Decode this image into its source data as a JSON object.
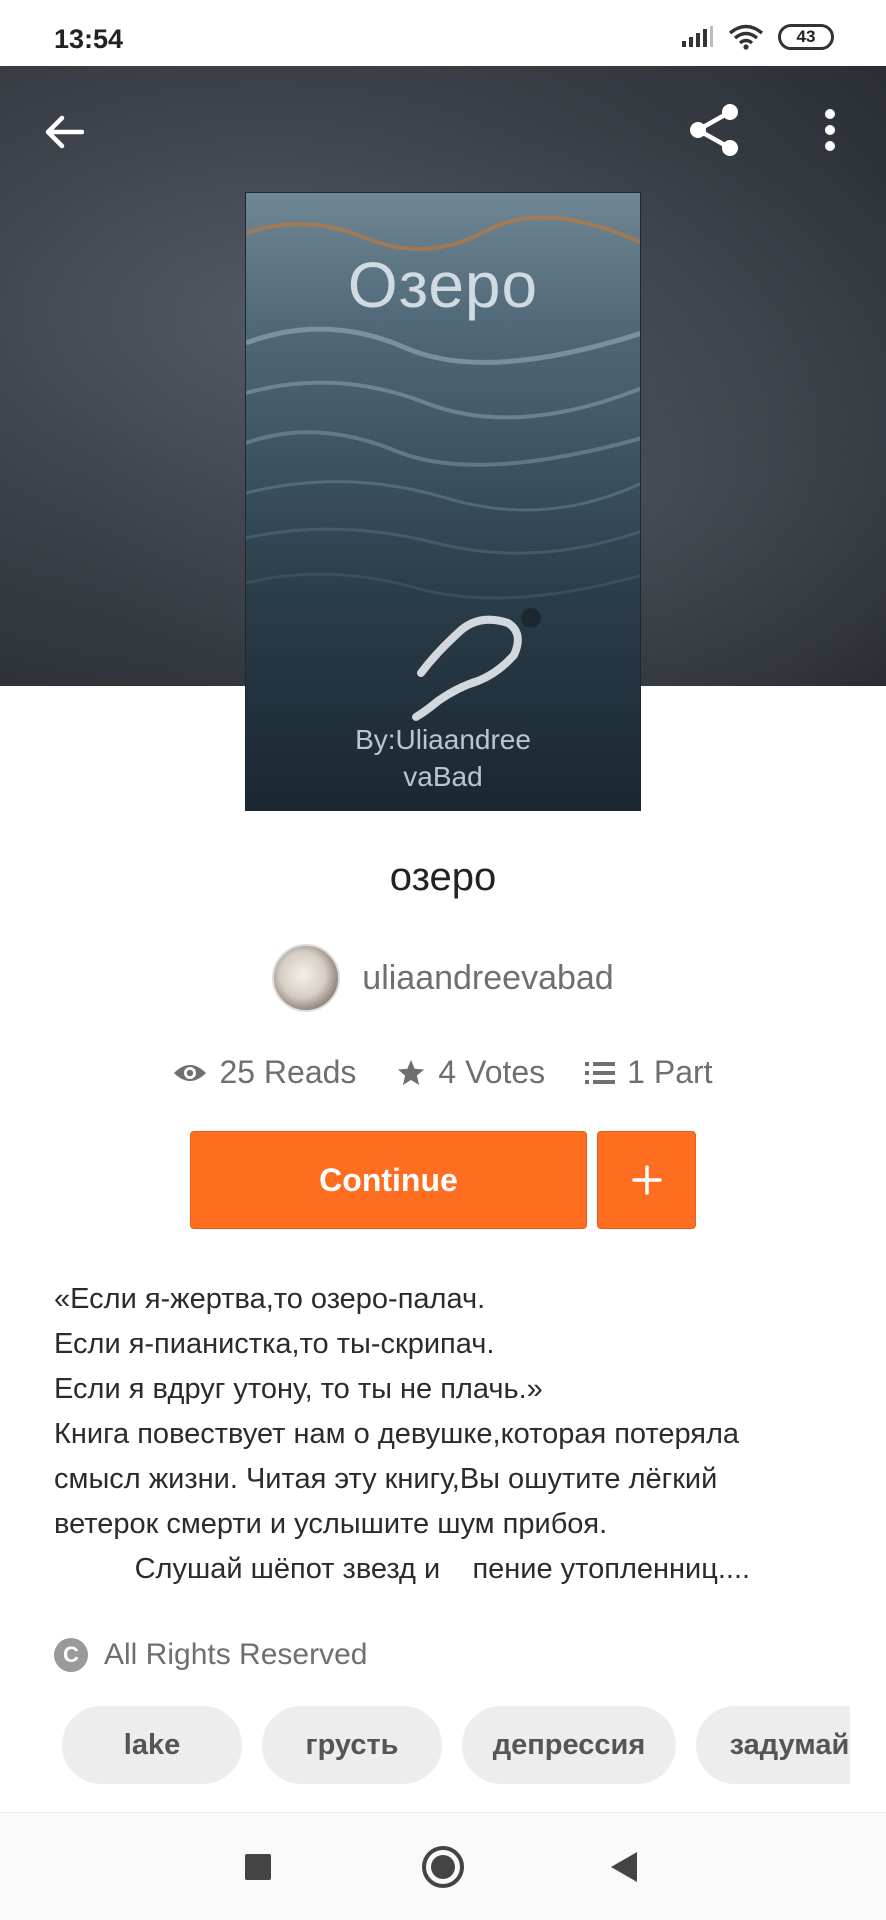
{
  "status_bar": {
    "time": "13:54",
    "battery": "43"
  },
  "hero": {
    "back_icon": "arrow-left-icon",
    "share_icon": "share-icon",
    "more_icon": "more-vertical-icon"
  },
  "cover": {
    "title": "Озеро",
    "author_line1": "By:Uliaandree",
    "author_line2": "vaBad"
  },
  "book": {
    "title": "озеро",
    "author": "uliaandreevabad"
  },
  "stats": {
    "reads": "25 Reads",
    "votes": "4 Votes",
    "parts": "1 Part"
  },
  "actions": {
    "continue_label": "Continue",
    "add_label": "+"
  },
  "description": "«Если я-жертва,то озеро-палач.\nЕсли я-пианистка,то ты-скрипач.\nЕсли я вдруг утону, то ты не плачь.»\nКнига повествует нам о девушке,которая потеряла\nсмысл жизни. Читая эту книгу,Вы ошутите лёгкий\nветерок смерти и услышите шум прибоя.\n          Слушай шёпот звезд и    пение утопленниц....",
  "rights": "All Rights Reserved",
  "tags": [
    "lake",
    "грусть",
    "депрессия",
    "задумайся"
  ],
  "nav": {
    "recents_icon": "square-icon",
    "home_icon": "circle-icon",
    "back_icon": "triangle-back-icon"
  },
  "colors": {
    "accent": "#ff6d21"
  }
}
